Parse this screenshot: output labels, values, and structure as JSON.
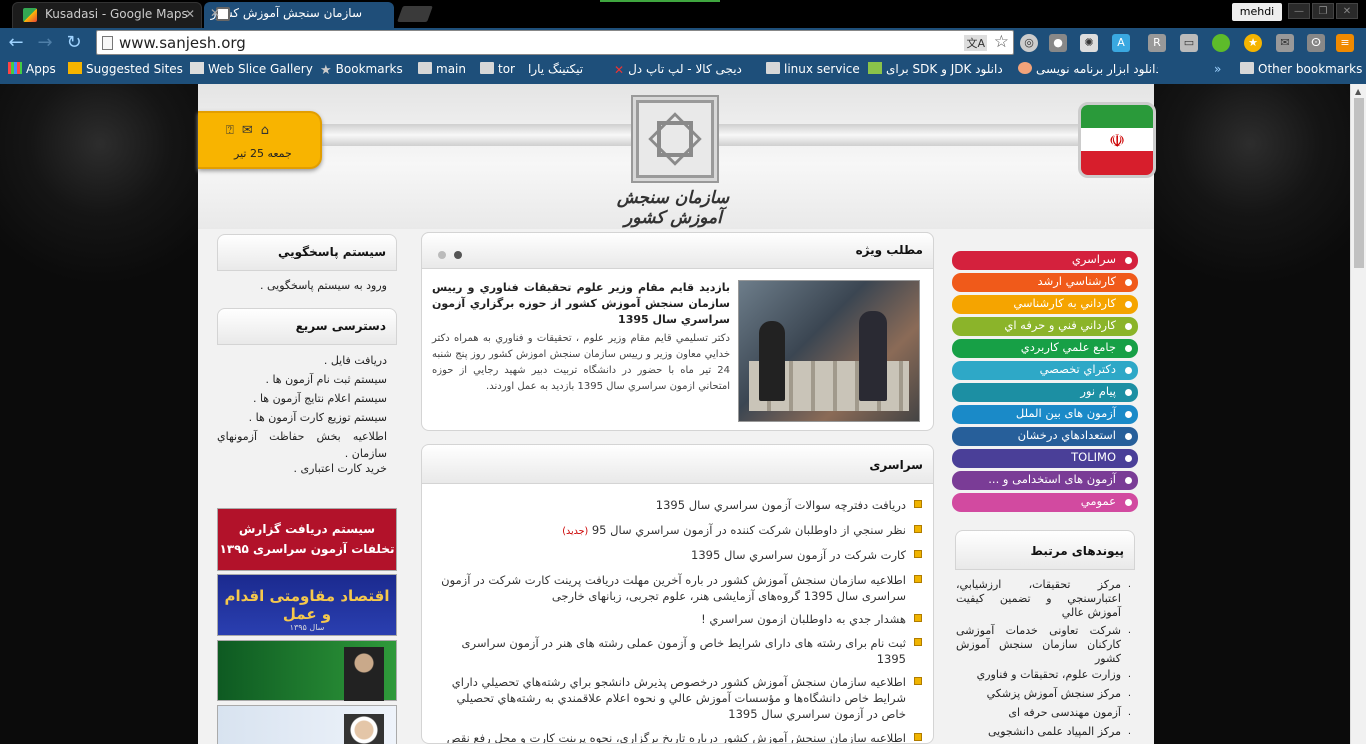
{
  "tabs": [
    {
      "title": "Kusadasi - Google Maps",
      "active": false
    },
    {
      "title": "سازمان سنجش آموزش کشور",
      "active": true
    }
  ],
  "user": "mehdi",
  "url": "www.sanjesh.org",
  "bookmarks": [
    {
      "label": "Apps",
      "icon": "apps-grid-icon"
    },
    {
      "label": "Suggested Sites",
      "icon": "bing-icon"
    },
    {
      "label": "Web Slice Gallery",
      "icon": "web-slice-icon"
    },
    {
      "label": "Bookmarks",
      "icon": "star-icon"
    },
    {
      "label": "main",
      "icon": "folder-icon"
    },
    {
      "label": "tor",
      "icon": "folder-icon"
    },
    {
      "label": "تیکتینگ یارا",
      "icon": "page-icon"
    },
    {
      "label": "دیجی کالا - لپ تاپ دل",
      "icon": "digikala-icon"
    },
    {
      "label": "linux service",
      "icon": "folder-icon"
    },
    {
      "label": "دانلود JDK و SDK برای",
      "icon": "page-icon"
    },
    {
      "label": "دانلود ابزار برنامه نویسی",
      "icon": "page-icon"
    },
    {
      "label": "Other bookmarks",
      "icon": "folder-icon"
    }
  ],
  "header": {
    "logo_text": "سازمان سنجش آموزش کشور",
    "date": "جمعه 25 تیر"
  },
  "left": {
    "support_title": "سيستم پاسخگويي",
    "support_link": "ورود به سیستم پاسخگویی",
    "quick_title": "دسترسی سریع",
    "quick_links": [
      "دريافت فايل",
      "سيستم ثبت نام آزمون ها",
      "سيستم اعلام نتايج آزمون ها",
      "سيستم توزيع کارت آزمون ها",
      "اطلاعيه بخش حفاظت آزمونهاي سازمان",
      "خرید کارت اعتباری"
    ],
    "banner1_line1": "سیستم دریافت گزارش",
    "banner1_line2": "تخلفات آزمون سراسری ۱۳۹۵",
    "banner2_text": "اقتصاد مقاومتی اقدام و عمل",
    "banner2_sub": "سال ۱۳۹۵"
  },
  "feature": {
    "title": "مطلب ويژه",
    "headline": "بازديد قايم مقام وزير علوم تحقيقات فناوري و رييس سازمان سنجش آموزش کشور از حوزه برگزاري آزمون سراسري سال 1395",
    "body": "دكتر تسليمي قايم مقام وزير علوم ، تحقيقات و فناوري به همراه دكتر خدايي معاون وزير و رييس سازمان سنجش اموزش كشور روز پنج شنبه 24 تير ماه با حضور در دانشگاه تربيت دبير شهيد رجايي از حوزه امتحاني ازمون سراسري سال 1395 بازديد به عمل اوردند."
  },
  "news": {
    "title": "سراسری",
    "new_label": "(جدید)",
    "items": [
      "دريافت دفترچه سوالات آزمون سراسري سال 1395",
      "نظر سنجي از داوطلبان شرکت کننده در آزمون سراسري سال 95",
      "کارت شرکت در آزمون سراسري سال 1395",
      "اطلاعیه سازمان سنجش آموزش کشور در باره آخرین مهلت دریافت پرینت کارت شرکت در آزمون سراسری سال 1395 گروه‌های آزمایشی هنر، علوم تجربی، زبانهای خارجی",
      "هشدار جدي به داوطلبان ازمون سراسري !",
      "ثبت نام برای رشته های دارای شرایط خاص و آزمون عملی رشته های هنر در آزمون سراسری 1395",
      "اطلاعيه سازمان سنجش آموزش کشور درخصوص پذيرش دانشجو براي رشته‌هاي تحصيلي داراي شرايط خاص دانشگاه‌ها و مؤسسات آموزش عالي و نحوه اعلام علاقمندي به رشته‌هاي تحصيلي خاص در آزمون سراسري سال 1395",
      "اطلاعیه سازمان سنجش آموزش کشور درباره تاریخ برگزاری، نحوه پرینت کارت و محل رفع نقص"
    ]
  },
  "categories": [
    {
      "label": "سراسري",
      "color": "#d4213d"
    },
    {
      "label": "کارشناسي ارشد",
      "color": "#f05a1a"
    },
    {
      "label": "کارداني به کارشناسي",
      "color": "#f5a400"
    },
    {
      "label": "کارداني فني و حرفه اي",
      "color": "#8bb42a"
    },
    {
      "label": "جامع علمي کاربردي",
      "color": "#17a046"
    },
    {
      "label": "دکتراي تخصصي",
      "color": "#2ea8c7"
    },
    {
      "label": "پيام نور",
      "color": "#1c8fa3"
    },
    {
      "label": "آزمون های بین الملل",
      "color": "#1a8ac8"
    },
    {
      "label": "استعدادهاي درخشان",
      "color": "#275f9a"
    },
    {
      "label": "TOLIMO",
      "color": "#4a3f98"
    },
    {
      "label": "آزمون های استخدامی و ...",
      "color": "#7a3c96"
    },
    {
      "label": "عمومي",
      "color": "#d24aa0"
    }
  ],
  "related": {
    "title": "پیوندهای مرتبط",
    "items": [
      "مرکز تحقيقات، ارزشيابي، اعتبارسنجي و تضمين کيفيت آموزش عالي",
      "شرکت تعاونی خدمات آموزشی کارکنان سازمان سنجش آموزش کشور",
      "وزارت علوم، تحقيقات و فناوري",
      "مرکز سنجش آموزش پزشکي",
      "آزمون مهندسی حرفه ای",
      "مرکز المپیاد علمی دانشجویی"
    ]
  }
}
